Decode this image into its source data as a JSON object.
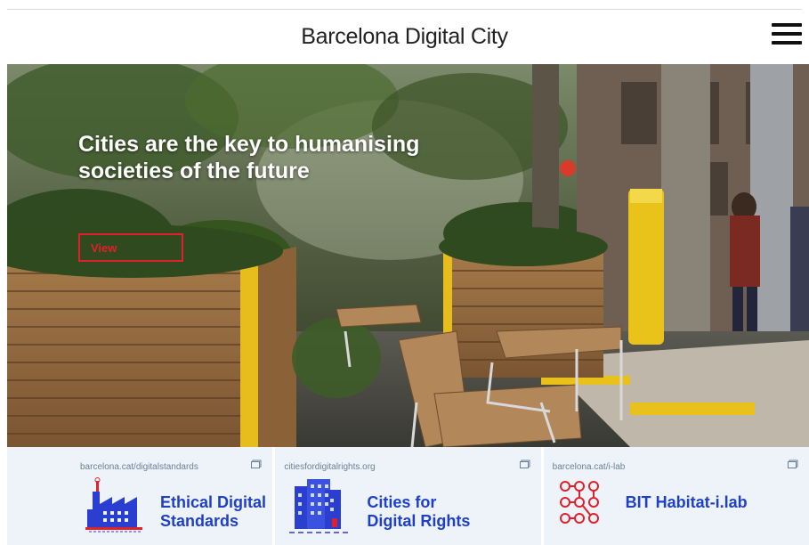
{
  "header": {
    "title": "Barcelona Digital City",
    "menu_icon": "hamburger-menu-icon"
  },
  "hero": {
    "headline": "Cities are the key to humanising societies of the future",
    "cta_label": "View",
    "accent_color": "#e0202a"
  },
  "cards": [
    {
      "url": "barcelona.cat/digitalstandards",
      "label": "Ethical Digital Standards",
      "icon": "factory-icon"
    },
    {
      "url": "citiesfordigitalrights.org",
      "label": "Cities for Digital Rights",
      "icon": "building-icon"
    },
    {
      "url": "barcelona.cat/i-lab",
      "label": "BIT Habitat-i.lab",
      "icon": "network-nodes-icon"
    }
  ],
  "colors": {
    "card_background": "#eef3f9",
    "card_text": "#1e3fc8",
    "icon_blue": "#2a3fd0",
    "icon_red": "#e0202a"
  }
}
